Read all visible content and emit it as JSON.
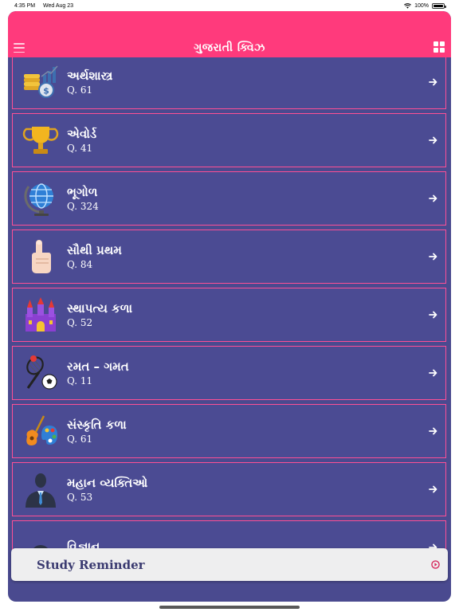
{
  "status_bar": {
    "time": "4:35 PM",
    "date": "Wed Aug 23",
    "battery": "100%"
  },
  "header": {
    "title": "ગુજરાતી ક્વિઝ"
  },
  "categories": [
    {
      "title": "અર્થશાસ્ત્ર",
      "count": "Q. 61",
      "icon": "coins-icon"
    },
    {
      "title": "એવોર્ડ",
      "count": "Q. 41",
      "icon": "trophy-icon"
    },
    {
      "title": "ભૂગોળ",
      "count": "Q. 324",
      "icon": "globe-icon"
    },
    {
      "title": "સૌથી પ્રથમ",
      "count": "Q. 84",
      "icon": "pointing-finger-icon"
    },
    {
      "title": "સ્થાપત્ય કળા",
      "count": "Q. 52",
      "icon": "castle-icon"
    },
    {
      "title": "રમત – ગમત",
      "count": "Q. 11",
      "icon": "sports-icon"
    },
    {
      "title": "સંસ્કૃતિ કળા",
      "count": "Q. 61",
      "icon": "guitar-palette-icon"
    },
    {
      "title": "મહાન વ્યક્તિઓ",
      "count": "Q. 53",
      "icon": "person-icon"
    },
    {
      "title": "વિજ્ઞાન",
      "count": "",
      "icon": "science-icon"
    }
  ],
  "reminder": {
    "label": "Study Reminder"
  },
  "colors": {
    "header": "#ff3a7c",
    "list_bg": "#4a4a8f",
    "item_border": "#ff4f96"
  }
}
